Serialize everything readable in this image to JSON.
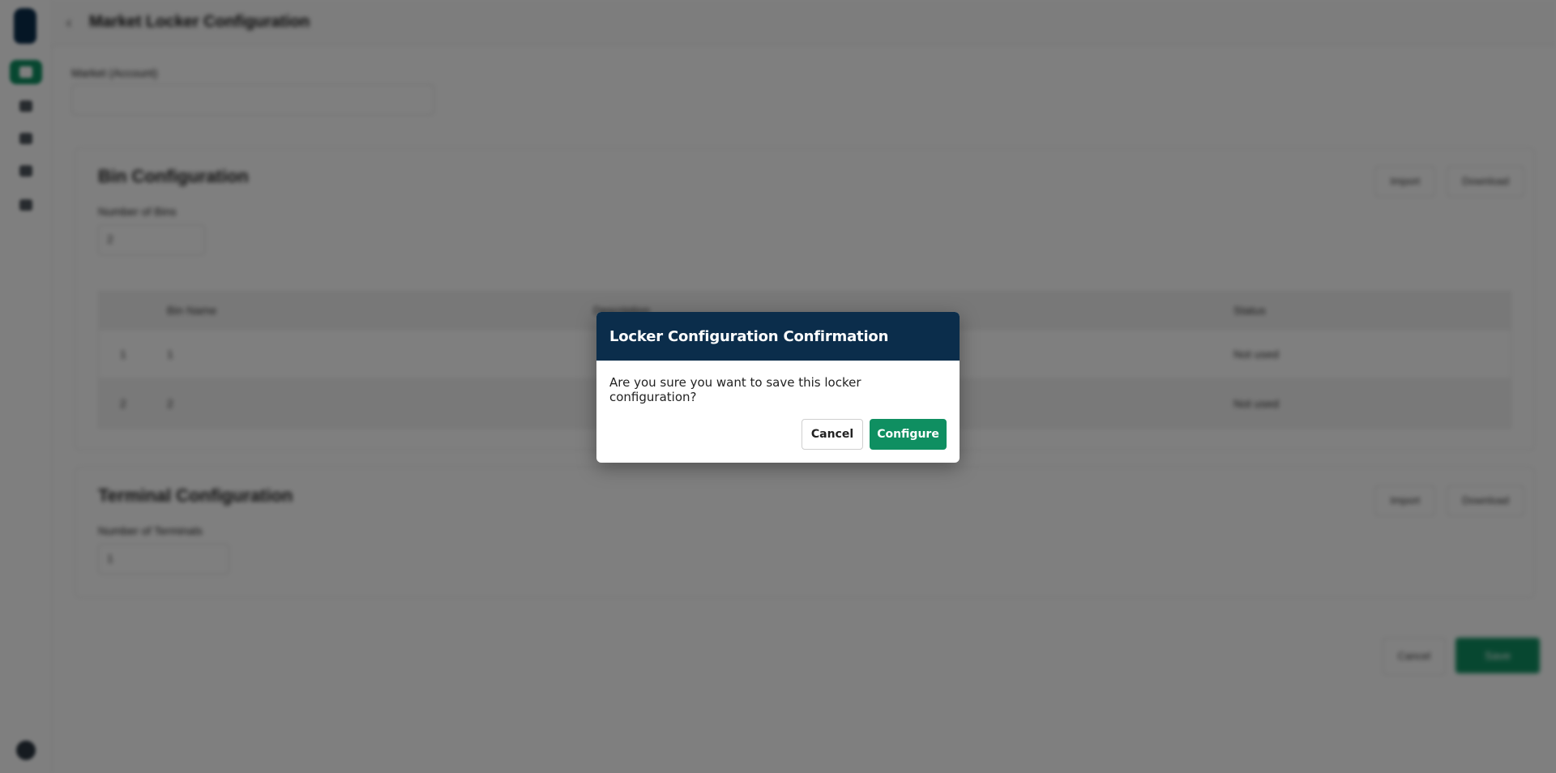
{
  "header": {
    "back_icon": "chevron-left-icon",
    "title": "Market Locker Configuration"
  },
  "sidebar": {
    "items": [
      {
        "icon": "grid-icon",
        "active": true
      },
      {
        "icon": "box-icon",
        "active": false
      },
      {
        "icon": "cart-icon",
        "active": false
      },
      {
        "icon": "tag-icon",
        "active": false
      },
      {
        "icon": "layers-icon",
        "active": false
      }
    ]
  },
  "form": {
    "market_label": "Market (Account)"
  },
  "bin_section": {
    "title": "Bin Configuration",
    "count_label": "Number of Bins",
    "count_value": "2",
    "actions": [
      "Import",
      "Download"
    ],
    "table": {
      "headers": [
        "Bin Name",
        "Description",
        "Status"
      ],
      "rows": [
        {
          "index": "1",
          "name": "1",
          "status": "Not used"
        },
        {
          "index": "2",
          "name": "2",
          "status": "Not used"
        }
      ]
    }
  },
  "terminal_section": {
    "title": "Terminal Configuration",
    "count_label": "Number of Terminals",
    "count_value": "1",
    "actions": [
      "Import",
      "Download"
    ]
  },
  "footer": {
    "cancel_label": "Cancel",
    "save_label": "Save"
  },
  "modal": {
    "title": "Locker Configuration Confirmation",
    "message": "Are you sure you want to save this locker configuration?",
    "cancel_label": "Cancel",
    "confirm_label": "Configure"
  },
  "colors": {
    "brand_navy": "#0b2d4b",
    "brand_green": "#0f8f61"
  }
}
